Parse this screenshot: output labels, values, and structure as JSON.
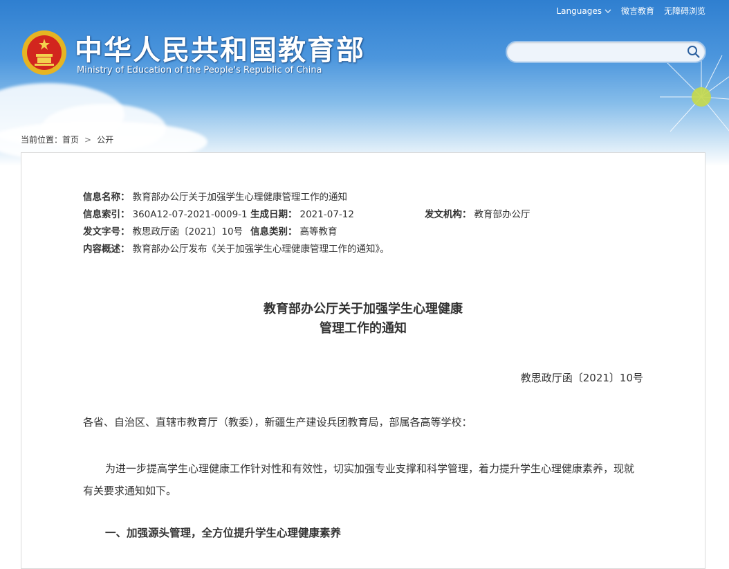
{
  "header": {
    "title_cn": "中华人民共和国教育部",
    "title_en": "Ministry of Education of the People's Republic of China",
    "top_links": {
      "languages": "Languages",
      "weiyan": "微言教育",
      "accessible": "无障碍浏览"
    },
    "search_placeholder": ""
  },
  "breadcrumb": {
    "prefix": "当前位置：",
    "home": "首页",
    "current": "公开"
  },
  "meta": {
    "name_label": "信息名称：",
    "name_value": "教育部办公厅关于加强学生心理健康管理工作的通知",
    "index_label": "信息索引：",
    "index_value": "360A12-07-2021-0009-1",
    "date_label": "生成日期：",
    "date_value": "2021-07-12",
    "org_label": "发文机构：",
    "org_value": "教育部办公厅",
    "docno_label": "发文字号：",
    "docno_value": "教思政厅函〔2021〕10号",
    "category_label": "信息类别：",
    "category_value": "高等教育",
    "summary_label": "内容概述：",
    "summary_value": "教育部办公厅发布《关于加强学生心理健康管理工作的通知》。"
  },
  "document": {
    "title_line1": "教育部办公厅关于加强学生心理健康",
    "title_line2": "管理工作的通知",
    "number": "教思政厅函〔2021〕10号",
    "salutation": "各省、自治区、直辖市教育厅（教委），新疆生产建设兵团教育局，部属各高等学校：",
    "paragraph1": "为进一步提高学生心理健康工作针对性和有效性，切实加强专业支撑和科学管理，着力提升学生心理健康素养，现就有关要求通知如下。",
    "heading1": "一、加强源头管理，全方位提升学生心理健康素养"
  },
  "colors": {
    "header_blue": "#2f7fd0",
    "text": "#333333",
    "border": "#d9d9d9"
  }
}
